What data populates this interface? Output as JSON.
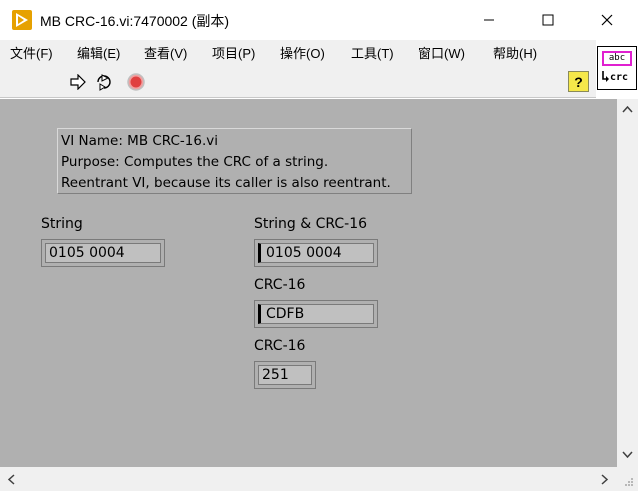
{
  "window": {
    "title": "MB CRC-16.vi:7470002 (副本)"
  },
  "menu": [
    {
      "label": "文件(F)"
    },
    {
      "label": "编辑(E)"
    },
    {
      "label": "查看(V)"
    },
    {
      "label": "项目(P)"
    },
    {
      "label": "操作(O)"
    },
    {
      "label": "工具(T)"
    },
    {
      "label": "窗口(W)"
    },
    {
      "label": "帮助(H)"
    }
  ],
  "toolbar": {
    "help_label": "?"
  },
  "connector_pane": {
    "top_text": "abc",
    "bottom_text": "crc"
  },
  "description": {
    "lines": [
      "VI Name: MB CRC-16.vi",
      "Purpose: Computes the CRC of a string.",
      "Reentrant VI, because its caller is also reentrant."
    ]
  },
  "controls": {
    "string": {
      "label": "String",
      "value": "0105 0004"
    },
    "string_crc": {
      "label": "String & CRC-16",
      "value": "0105 0004"
    },
    "crc16_hex": {
      "label": "CRC-16",
      "value": "CDFB"
    },
    "crc16_dec": {
      "label": "CRC-16",
      "value": "251"
    }
  },
  "colors": {
    "panel": "#b0b0b0",
    "help_button": "#f5e84a",
    "abort_button": "#e04040",
    "app_icon": "#e6a100"
  }
}
